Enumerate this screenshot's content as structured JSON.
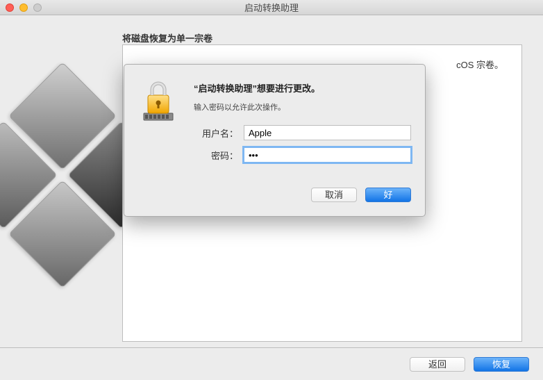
{
  "window": {
    "title": "启动转换助理"
  },
  "page": {
    "heading": "将磁盘恢复为单一宗卷",
    "partial_text": "cOS 宗卷。"
  },
  "bottom_buttons": {
    "back": "返回",
    "restore": "恢复"
  },
  "auth_dialog": {
    "title": "“启动转换助理”想要进行更改。",
    "subtitle": "输入密码以允许此次操作。",
    "username_label": "用户名：",
    "username_value": "Apple",
    "password_label": "密码：",
    "password_value": "•••",
    "cancel": "取消",
    "ok": "好"
  }
}
